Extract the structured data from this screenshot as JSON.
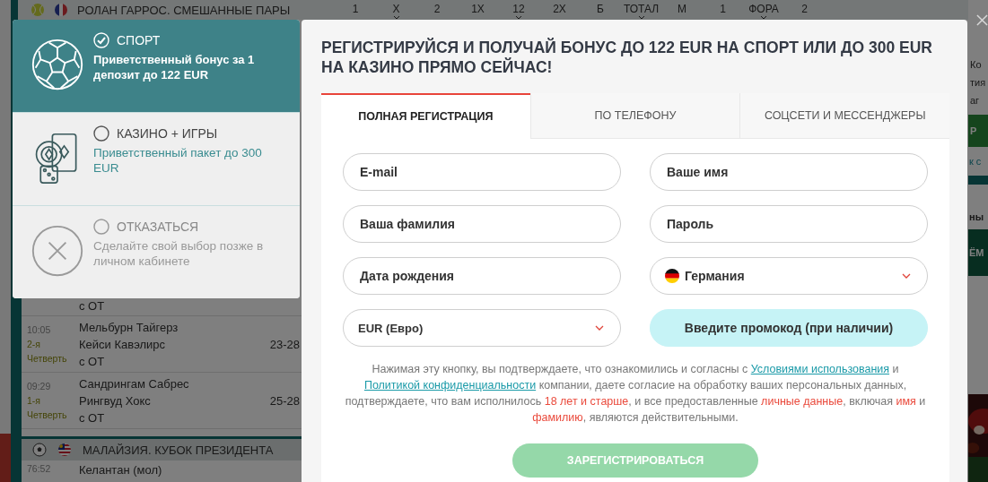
{
  "background": {
    "league_header": {
      "title": "РОЛАН ГАРРОС. СМЕШАННЫЕ ПАРЫ",
      "columns": [
        {
          "label": "1",
          "dropdown": false
        },
        {
          "label": "X",
          "dropdown": true
        },
        {
          "label": "2",
          "dropdown": false
        },
        {
          "label": "1X",
          "dropdown": false
        },
        {
          "label": "12",
          "dropdown": true
        },
        {
          "label": "2X",
          "dropdown": false
        },
        {
          "label": "Б",
          "dropdown": false
        },
        {
          "label": "ТОТАЛ",
          "dropdown": true
        },
        {
          "label": "М",
          "dropdown": false
        },
        {
          "label": "1",
          "dropdown": false
        },
        {
          "label": "ФОРА",
          "dropdown": true
        },
        {
          "label": "2",
          "dropdown": false
        }
      ]
    },
    "partial_row": {
      "note": "с ОТ"
    },
    "matches": [
      {
        "time": "10:05",
        "period": "2-я",
        "period_label": "Четверть",
        "teams": [
          "Мельбурн Тайгерз",
          "Кейси Кавэлирс"
        ],
        "note": "с ОТ",
        "score": "23-28"
      },
      {
        "time": "09:29",
        "period": "1-я",
        "period_label": "Четверть",
        "teams": [
          "Сандрингам Сабрес",
          "Рингвуд Хокс"
        ],
        "note": "с ОТ",
        "score": "25-28"
      }
    ],
    "section": {
      "title": "МАЛАЙЗИЯ. КУБОК ПРЕЗИДЕНТА"
    },
    "next_match": {
      "time": "76:52",
      "team": "Келантан (мол)"
    },
    "right_fragments": [
      {
        "kind": "text",
        "text": "Ко"
      },
      {
        "kind": "text",
        "text": "тия"
      },
      {
        "kind": "text",
        "text": "аг"
      },
      {
        "kind": "green-band",
        "text": "Р"
      },
      {
        "kind": "link",
        "text": "к с"
      },
      {
        "kind": "bold",
        "text": "ны"
      },
      {
        "kind": "dark-band",
        "text": "ЁМ"
      }
    ]
  },
  "bonus_options": [
    {
      "kind": "sport",
      "title": "СПОРТ",
      "description": "Приветственный бонус за 1 депозит до 122 EUR",
      "selected": true
    },
    {
      "kind": "casino",
      "title": "КАЗИНО + ИГРЫ",
      "description": "Приветственный пакет до 300 EUR",
      "selected": false
    },
    {
      "kind": "decline",
      "title": "ОТКАЗАТЬСЯ",
      "description": "Сделайте свой выбор позже в личном кабинете",
      "selected": false
    }
  ],
  "registration": {
    "title": "РЕГИСТРИРУЙСЯ И ПОЛУЧАЙ БОНУС ДО 122 EUR НА СПОРТ ИЛИ ДО 300 EUR НА КАЗИНО ПРЯМО СЕЙЧАС!",
    "tabs": [
      {
        "label": "ПОЛНАЯ РЕГИСТРАЦИЯ",
        "selected": true
      },
      {
        "label": "ПО ТЕЛЕФОНУ",
        "selected": false
      },
      {
        "label": "СОЦСЕТИ И МЕССЕНДЖЕРЫ",
        "selected": false
      }
    ],
    "fields": [
      {
        "kind": "input",
        "placeholder": "E-mail"
      },
      {
        "kind": "input",
        "placeholder": "Ваше имя"
      },
      {
        "kind": "input",
        "placeholder": "Ваша фамилия"
      },
      {
        "kind": "input",
        "placeholder": "Пароль"
      },
      {
        "kind": "input",
        "placeholder": "Дата рождения"
      },
      {
        "kind": "country",
        "value": "Германия"
      },
      {
        "kind": "select",
        "value": "EUR (Евро)"
      },
      {
        "kind": "promo",
        "placeholder": "Введите промокод (при наличии)"
      }
    ],
    "consent": [
      {
        "kind": "text",
        "text": "Нажимая эту кнопку, вы подтверждаете, что ознакомились и согласны с "
      },
      {
        "kind": "link",
        "text": "Условиями использования"
      },
      {
        "kind": "text",
        "text": " и "
      },
      {
        "kind": "link",
        "text": "Политикой конфиденциальности"
      },
      {
        "kind": "text",
        "text": " компании, даете согласие на обработку ваших персональных данных, подтверждаете, что вам исполнилось "
      },
      {
        "kind": "highlight",
        "text": "18 лет и старше"
      },
      {
        "kind": "text",
        "text": ", и все предоставленные "
      },
      {
        "kind": "highlight",
        "text": "личные данные"
      },
      {
        "kind": "text",
        "text": ", включая "
      },
      {
        "kind": "highlight",
        "text": "имя"
      },
      {
        "kind": "text",
        "text": " и "
      },
      {
        "kind": "highlight",
        "text": "фамилию"
      },
      {
        "kind": "text",
        "text": ", являются действительными."
      }
    ],
    "submit": "ЗАРЕГИСТРИРОВАТЬСЯ"
  }
}
